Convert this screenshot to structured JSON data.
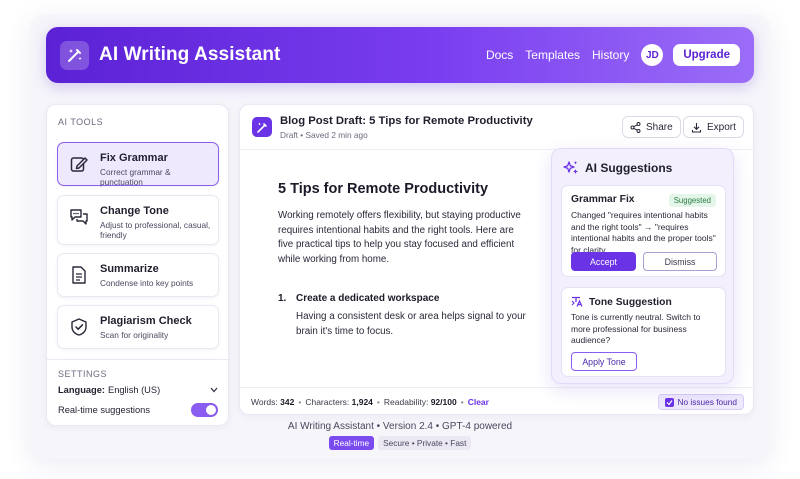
{
  "header": {
    "title": "AI Writing Assistant",
    "nav": [
      "Docs",
      "Templates",
      "History"
    ],
    "avatar_initials": "JD",
    "upgrade_label": "Upgrade"
  },
  "sidebar": {
    "tools_label": "AI TOOLS",
    "tools": [
      {
        "name": "Fix Grammar",
        "desc": "Correct grammar & punctuation",
        "icon": "pen-edit-icon",
        "active": true
      },
      {
        "name": "Change Tone",
        "desc": "Adjust to professional, casual, friendly",
        "icon": "chat-bubbles-icon",
        "active": false
      },
      {
        "name": "Summarize",
        "desc": "Condense into key points",
        "icon": "document-lines-icon",
        "active": false
      },
      {
        "name": "Plagiarism Check",
        "desc": "Scan for originality",
        "icon": "shield-check-icon",
        "active": false
      }
    ],
    "settings_label": "SETTINGS",
    "language_label": "Language:",
    "language_value": "English (US)",
    "realtime_label": "Real-time suggestions",
    "realtime_enabled": true
  },
  "editor": {
    "doc_title": "Blog Post Draft: 5 Tips for Remote Productivity",
    "doc_status": "Draft • Saved 2 min ago",
    "share_label": "Share",
    "export_label": "Export",
    "heading": "5 Tips for Remote Productivity",
    "intro": "Working remotely offers flexibility, but staying productive requires intentional habits and the right tools. Here are five practical tips to help you stay focused and efficient while working from home.",
    "list_number": "1.",
    "list_title": "Create a dedicated workspace",
    "list_text": "Having a consistent desk or area helps signal to your brain it's time to focus."
  },
  "status": {
    "words_label": "Words:",
    "words": "342",
    "chars_label": "Characters:",
    "chars": "1,924",
    "readability_label": "Readability:",
    "readability": "92/100",
    "clear_label": "Clear",
    "issues_label": "No issues found"
  },
  "ai_panel": {
    "title": "AI Suggestions",
    "grammar": {
      "title": "Grammar Fix",
      "badge": "Suggested",
      "text": "Changed \"requires intentional habits and the right tools\" → \"requires intentional habits and the proper tools\" for clarity",
      "accept_label": "Accept",
      "dismiss_label": "Dismiss"
    },
    "tone": {
      "title": "Tone Suggestion",
      "text": "Tone is currently neutral. Switch to more professional for business audience?",
      "apply_label": "Apply Tone"
    }
  },
  "footer": {
    "line": "AI Writing Assistant • Version 2.4 • GPT-4 powered",
    "badge_primary": "Real-time",
    "badge_secondary": "Secure • Private • Fast"
  },
  "colors": {
    "accent": "#6a33e6",
    "header_gradient_start": "#5b21d4",
    "header_gradient_end": "#9b6df7",
    "success": "#2b7d45"
  }
}
